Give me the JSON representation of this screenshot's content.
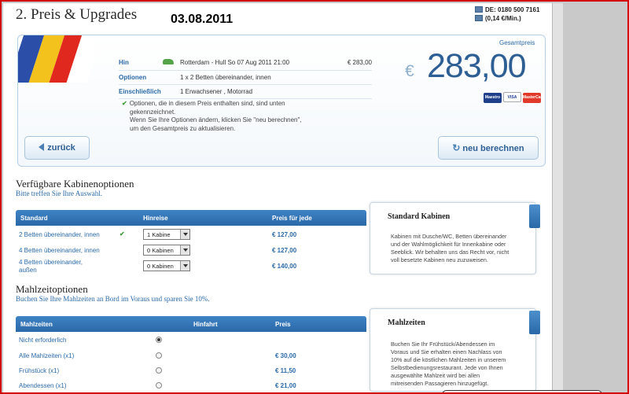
{
  "header": {
    "title": "2. Preis & Upgrades",
    "date": "03.08.2011",
    "phone": "DE: 0180 500 7161",
    "rate": "(0,14 €/Min.)"
  },
  "summary": {
    "rows": [
      {
        "label": "Hin",
        "value": "Rotterdam - Hull So 07 Aug 2011 21:00",
        "price": "€ 283,00"
      },
      {
        "label": "Optionen",
        "value": "1 x 2 Betten übereinander, innen",
        "price": ""
      },
      {
        "label": "Einschließlich",
        "value": "1 Erwachsener , Motorrad",
        "price": ""
      }
    ],
    "note_line1": "Optionen, die in diesem Preis enthalten sind, sind unten",
    "note_line2": "gekennzeichnet.",
    "note_line3": "Wenn Sie Ihre Optionen ändern, klicken Sie \"neu berechnen\",",
    "note_line4": "um den Gesamtpreis zu aktualisieren.",
    "total_label": "Gesamtpreis",
    "currency": "€",
    "total": "283,00",
    "cards": [
      "Maestro",
      "VISA",
      "MasterCard"
    ],
    "back_label": "zurück",
    "recalc_label": "neu berechnen"
  },
  "cabins": {
    "title": "Verfügbare Kabinenoptionen",
    "subtitle": "Bitte treffen Sie Ihre Auswahl.",
    "columns": [
      "Standard",
      "Hinreise",
      "Preis für jede"
    ],
    "rows": [
      {
        "name": "2 Betten übereinander, innen",
        "select": "1 Kabine",
        "price": "€ 127,00",
        "checked": true
      },
      {
        "name": "4 Betten übereinander, innen",
        "select": "0 Kabinen",
        "price": "€ 127,00",
        "checked": false
      },
      {
        "name_line1": "4 Betten übereinander,",
        "name_line2": "außen",
        "select": "0 Kabinen",
        "price": "€ 140,00",
        "checked": false
      }
    ],
    "info_title": "Standard Kabinen",
    "info_text": [
      "Kabinen mit Dusche/WC, Betten übereinander",
      "und der Wahlmöglichkeit für Innenkabine oder",
      "Seeblick. Wir behalten uns das Recht vor, nicht",
      "voll besetzte Kabinen neu zuzuweisen."
    ]
  },
  "meals": {
    "title": "Mahlzeitoptionen",
    "subtitle": "Buchen Sie Ihre Mahlzeiten an Bord im Voraus und sparen Sie 10%.",
    "columns": [
      "Mahlzeiten",
      "Hinfahrt",
      "Preis"
    ],
    "rows": [
      {
        "name": "Nicht erforderlich",
        "price": "",
        "selected": true
      },
      {
        "name": "Alle Mahlzeiten  (x1)",
        "price": "€ 30,00",
        "selected": false
      },
      {
        "name": "Frühstück  (x1)",
        "price": "€ 11,50",
        "selected": false
      },
      {
        "name": "Abendessen  (x1)",
        "price": "€ 21,00",
        "selected": false
      }
    ],
    "info_title": "Mahlzeiten",
    "info_text": [
      "Buchen Sie Ihr Frühstück/Abendessen im",
      "Voraus und Sie erhalten einen Nachlass von",
      "10% auf die köstlichen Mahlzeiten in unserem",
      "Selbstbedienungsrestaurant. Jede von Ihnen",
      "ausgewählte Mahlzeit wird bei allen",
      "mitreisenden Passagieren hinzugefügt."
    ]
  }
}
